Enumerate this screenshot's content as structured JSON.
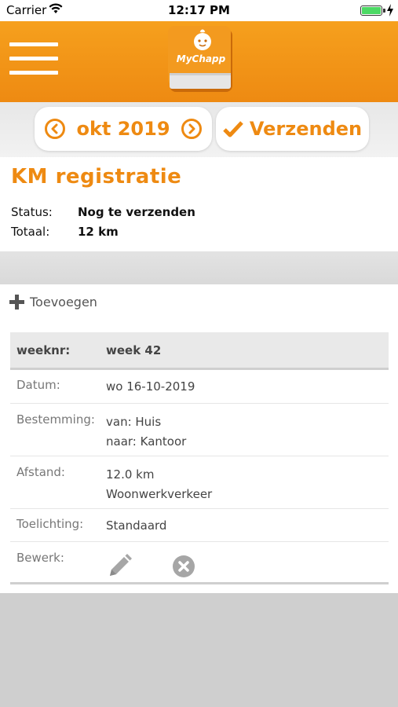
{
  "status_bar": {
    "carrier": "Carrier",
    "time": "12:17 PM",
    "battery_color": "#4cd964"
  },
  "header": {
    "menu_icon": "hamburger-menu-icon",
    "logo_text": "MyChapp",
    "accent_color": "#ee8a12"
  },
  "toolbar": {
    "prev_icon": "chevron-left-circle-icon",
    "month": "okt 2019",
    "next_icon": "chevron-right-circle-icon",
    "send_icon": "checkmark-icon",
    "send_label": "Verzenden"
  },
  "summary": {
    "title": "KM registratie",
    "status_label": "Status:",
    "status_value": "Nog te verzenden",
    "total_label": "Totaal:",
    "total_value": "12 km"
  },
  "add_label": "Toevoegen",
  "entry": {
    "week_label": "weeknr:",
    "week_value": "week 42",
    "date_label": "Datum:",
    "date_value": "wo 16-10-2019",
    "destination_label": "Bestemming:",
    "destination_from": "van: Huis",
    "destination_to": "naar: Kantoor",
    "distance_label": "Afstand:",
    "distance_value": "12.0 km",
    "distance_type": "Woonwerkverkeer",
    "note_label": "Toelichting:",
    "note_value": "Standaard",
    "edit_label": "Bewerk:",
    "edit_icon": "pencil-icon",
    "delete_icon": "delete-circle-icon"
  }
}
